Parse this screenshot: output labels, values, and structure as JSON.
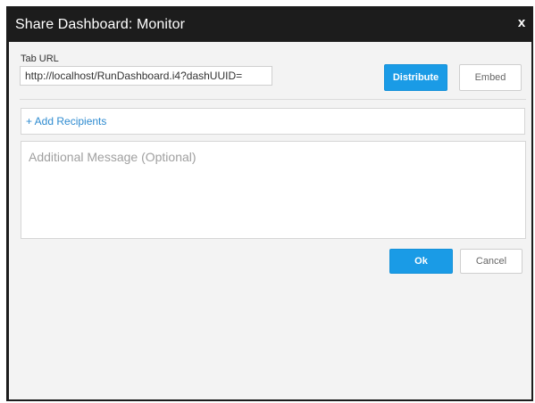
{
  "dialog": {
    "title": "Share Dashboard: Monitor",
    "close_label": "x"
  },
  "url": {
    "label": "Tab URL",
    "value": "http://localhost/RunDashboard.i4?dashUUID="
  },
  "actions": {
    "distribute_label": "Distribute",
    "embed_label": "Embed"
  },
  "recipients": {
    "add_label": "+ Add Recipients"
  },
  "message": {
    "placeholder": "Additional Message (Optional)"
  },
  "footer": {
    "ok_label": "Ok",
    "cancel_label": "Cancel"
  },
  "colors": {
    "primary": "#1a9be6",
    "titlebar": "#1c1c1c",
    "link": "#2e8bd0"
  }
}
